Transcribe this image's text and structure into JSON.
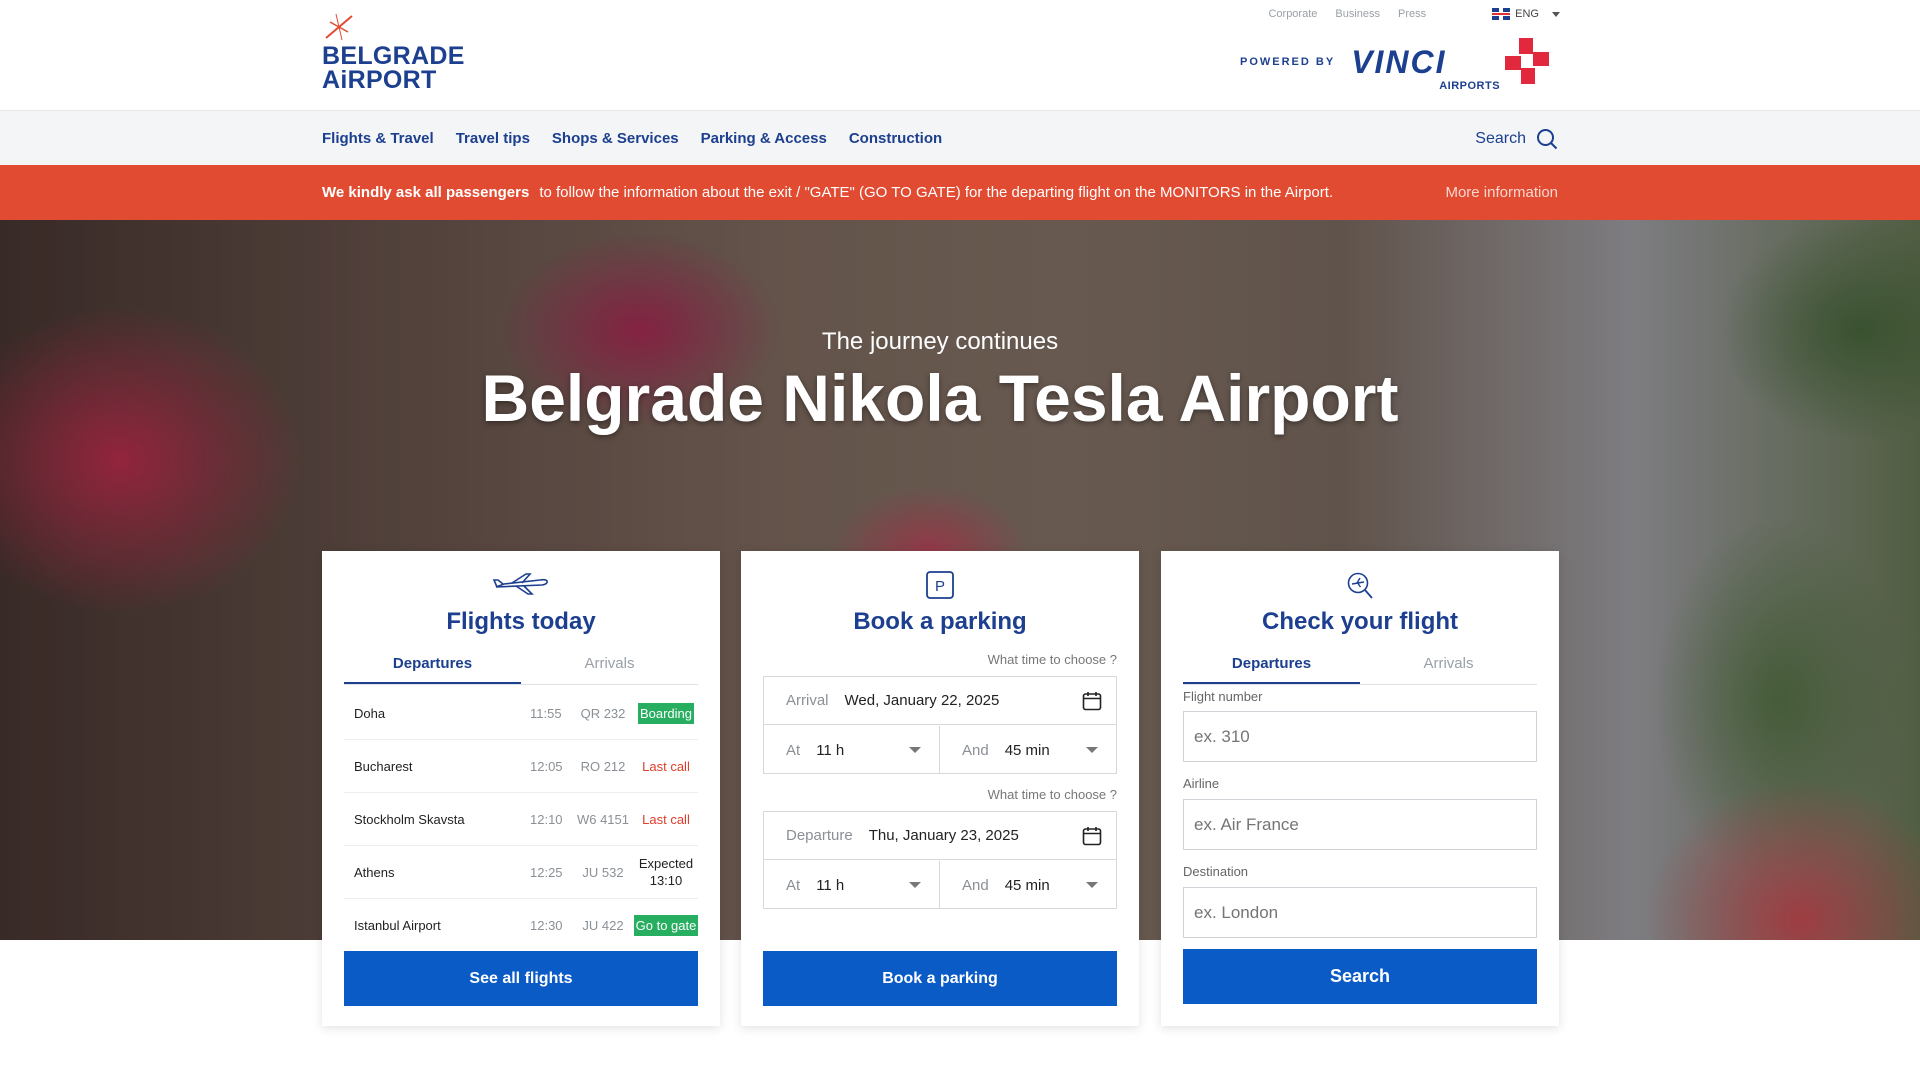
{
  "header": {
    "logo_line1": "BELGRADE",
    "logo_line2": "AiRPORT",
    "utility_links": [
      "Corporate",
      "Business",
      "Press"
    ],
    "language": "ENG",
    "powered_by": "POWERED BY",
    "vinci_word": "VINCI",
    "vinci_sub": "AIRPORTS"
  },
  "nav": {
    "items": [
      "Flights & Travel",
      "Travel tips",
      "Shops & Services",
      "Parking & Access",
      "Construction"
    ],
    "search_label": "Search"
  },
  "alert": {
    "bold": "We kindly ask all passengers",
    "text": "to follow the information about the exit / \"GATE\" (GO TO GATE) for the departing flight on the MONITORS in the Airport.",
    "more": "More information"
  },
  "hero": {
    "subtitle": "The journey continues",
    "title": "Belgrade Nikola Tesla Airport"
  },
  "flights_card": {
    "title": "Flights today",
    "tabs": [
      "Departures",
      "Arrivals"
    ],
    "rows": [
      {
        "city": "Doha",
        "time": "11:55",
        "code": "QR 232",
        "status": "Boarding"
      },
      {
        "city": "Bucharest",
        "time": "12:05",
        "code": "RO 212",
        "status": "Last call"
      },
      {
        "city": "Stockholm Skavsta",
        "time": "12:10",
        "code": "W6 4151",
        "status": "Last call"
      },
      {
        "city": "Athens",
        "time": "12:25",
        "code": "JU 532",
        "status": "Expected 13:10"
      },
      {
        "city": "Istanbul Airport",
        "time": "12:30",
        "code": "JU 422",
        "status": "Go to gate"
      }
    ],
    "button": "See all flights"
  },
  "parking_card": {
    "title": "Book a parking",
    "hint": "What time to choose ?",
    "arrival": {
      "label": "Arrival",
      "date": "Wed, January 22, 2025",
      "at_label": "At",
      "hour": "11 h",
      "and_label": "And",
      "min": "45 min"
    },
    "departure": {
      "label": "Departure",
      "date": "Thu, January 23, 2025",
      "at_label": "At",
      "hour": "11 h",
      "and_label": "And",
      "min": "45 min"
    },
    "button": "Book a parking"
  },
  "check_card": {
    "title": "Check your flight",
    "tabs": [
      "Departures",
      "Arrivals"
    ],
    "flight_number_label": "Flight number",
    "flight_number_placeholder": "ex. 310",
    "airline_label": "Airline",
    "airline_placeholder": "ex. Air France",
    "destination_label": "Destination",
    "destination_placeholder": "ex. London",
    "button": "Search"
  },
  "colors": {
    "brand_blue": "#1c3f8f",
    "button_blue": "#0b5bc6",
    "alert_red": "#e14b32",
    "status_green": "#27ae60",
    "status_red": "#e03c28"
  }
}
